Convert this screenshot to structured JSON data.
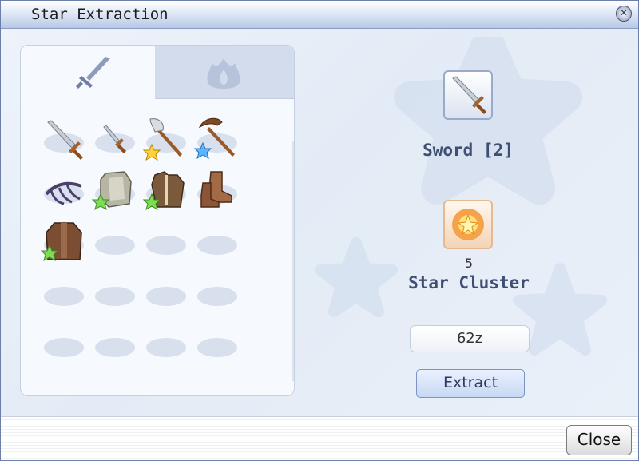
{
  "window": {
    "title": "Star Extraction",
    "close_icon": "close-x-icon"
  },
  "tabs": [
    {
      "name": "weapon",
      "icon": "sword-icon",
      "selected": true
    },
    {
      "name": "armor",
      "icon": "flame-icon",
      "selected": false
    }
  ],
  "inventory": {
    "items": [
      {
        "icon": "sword-icon",
        "star": null
      },
      {
        "icon": "dagger-icon",
        "star": null
      },
      {
        "icon": "axe-icon",
        "star": "yellow"
      },
      {
        "icon": "hammer-icon",
        "star": "blue"
      },
      {
        "icon": "claw-icon",
        "star": null
      },
      {
        "icon": "shield-armor-icon",
        "star": "green"
      },
      {
        "icon": "coat-icon",
        "star": "green"
      },
      {
        "icon": "boots-icon",
        "star": null
      },
      {
        "icon": "robe-icon",
        "star": "green"
      }
    ],
    "empty_slots": 11
  },
  "selected_item": {
    "name": "Sword [2]",
    "icon": "sword-icon"
  },
  "material": {
    "name": "Star Cluster",
    "count": "5",
    "icon": "star-cluster-icon"
  },
  "cost": "62z",
  "buttons": {
    "extract": "Extract",
    "close": "Close"
  },
  "colors": {
    "title_text": "#3f4e73",
    "tab_inactive": "#d3dcec",
    "panel_bg": "#f6f9fd"
  }
}
